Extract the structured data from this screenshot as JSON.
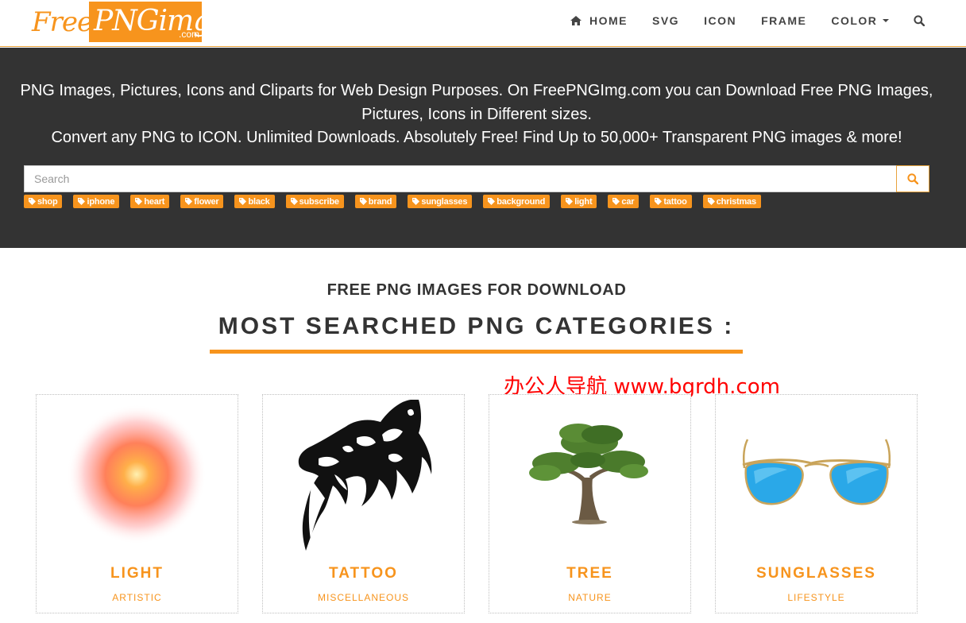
{
  "brand": {
    "logo_free": "Free",
    "logo_png": "PNGimg",
    "logo_dotcom": ".com"
  },
  "nav": {
    "home": "HOME",
    "svg": "SVG",
    "icon": "ICON",
    "frame": "FRAME",
    "color": "COLOR"
  },
  "hero": {
    "line1": "PNG Images, Pictures, Icons and Cliparts for Web Design Purposes. On FreePNGImg.com you can Download Free PNG Images, Pictures, Icons in Different sizes.",
    "line2": "Convert any PNG to ICON. Unlimited Downloads. Absolutely Free! Find Up to 50,000+ Transparent PNG images & more!"
  },
  "search": {
    "placeholder": "Search"
  },
  "tags": [
    "shop",
    "iphone",
    "heart",
    "flower",
    "black",
    "subscribe",
    "brand",
    "sunglasses",
    "background",
    "light",
    "car",
    "tattoo",
    "christmas"
  ],
  "section": {
    "subheading": "FREE PNG IMAGES FOR DOWNLOAD",
    "heading": "MOST SEARCHED PNG CATEGORIES :"
  },
  "watermark": "办公人导航 www.bgrdh.com",
  "cards": [
    {
      "title": "LIGHT",
      "category": "ARTISTIC"
    },
    {
      "title": "TATTOO",
      "category": "MISCELLANEOUS"
    },
    {
      "title": "TREE",
      "category": "NATURE"
    },
    {
      "title": "SUNGLASSES",
      "category": "LIFESTYLE"
    }
  ],
  "colors": {
    "accent": "#f7941d",
    "hero_bg": "#333333",
    "watermark": "#ff0000"
  }
}
